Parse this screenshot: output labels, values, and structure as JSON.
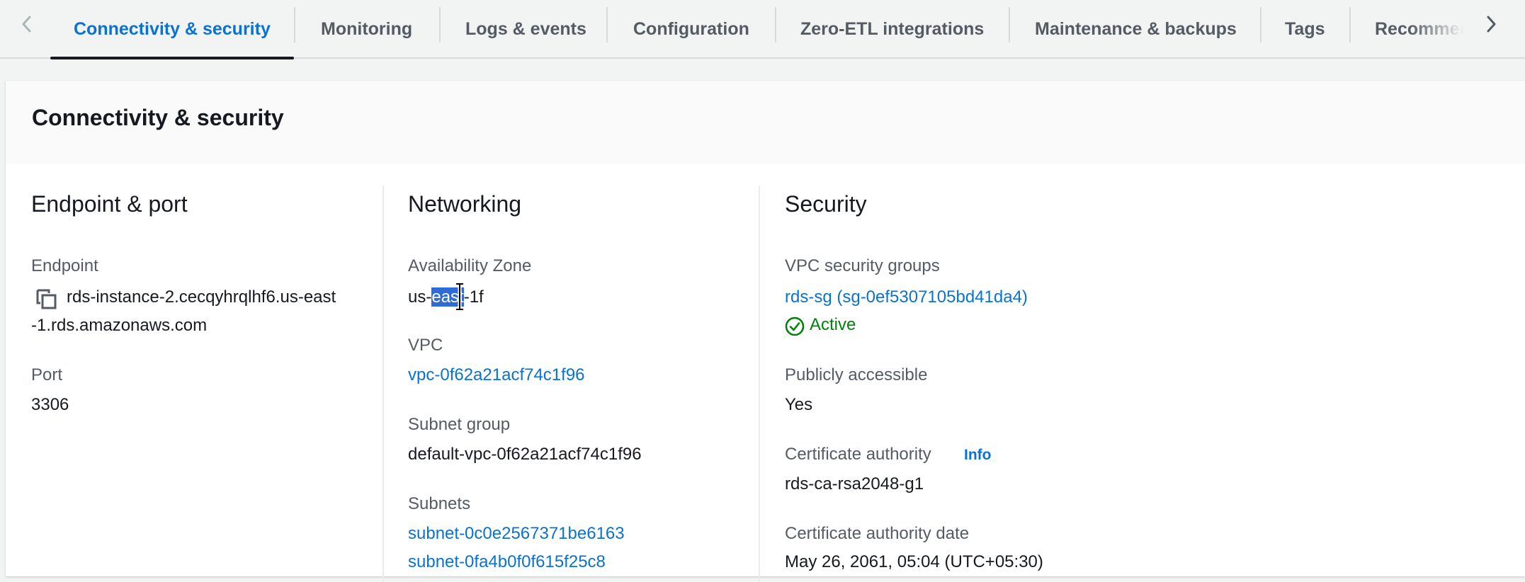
{
  "tabs": [
    {
      "label": "Connectivity & security"
    },
    {
      "label": "Monitoring"
    },
    {
      "label": "Logs & events"
    },
    {
      "label": "Configuration"
    },
    {
      "label": "Zero-ETL integrations"
    },
    {
      "label": "Maintenance & backups"
    },
    {
      "label": "Tags"
    },
    {
      "label": "Recommen"
    }
  ],
  "section": {
    "title": "Connectivity & security"
  },
  "endpoint_port": {
    "title": "Endpoint & port",
    "endpoint_label": "Endpoint",
    "endpoint_line1": "rds-instance-2.cecqyhrqlhf6.us-east",
    "endpoint_line2": "-1.rds.amazonaws.com",
    "port_label": "Port",
    "port_value": "3306"
  },
  "networking": {
    "title": "Networking",
    "az_label": "Availability Zone",
    "az_pre": "us-",
    "az_sel": "east",
    "az_post": "-1f",
    "vpc_label": "VPC",
    "vpc_value": "vpc-0f62a21acf74c1f96",
    "subnet_group_label": "Subnet group",
    "subnet_group_value": "default-vpc-0f62a21acf74c1f96",
    "subnets_label": "Subnets",
    "subnet_1": "subnet-0c0e2567371be6163",
    "subnet_2": "subnet-0fa4b0f0f615f25c8"
  },
  "security": {
    "title": "Security",
    "sg_label": "VPC security groups",
    "sg_value": "rds-sg (sg-0ef5307105bd41da4)",
    "sg_status": "Active",
    "public_label": "Publicly accessible",
    "public_value": "Yes",
    "ca_label": "Certificate authority",
    "ca_info": "Info",
    "ca_value": "rds-ca-rsa2048-g1",
    "ca_date_label": "Certificate authority date",
    "ca_date_value": "May 26, 2061, 05:04 (UTC+05:30)"
  },
  "colors": {
    "accent": "#0972d3",
    "success": "#037f0c",
    "selection": "#2f6bd6"
  }
}
